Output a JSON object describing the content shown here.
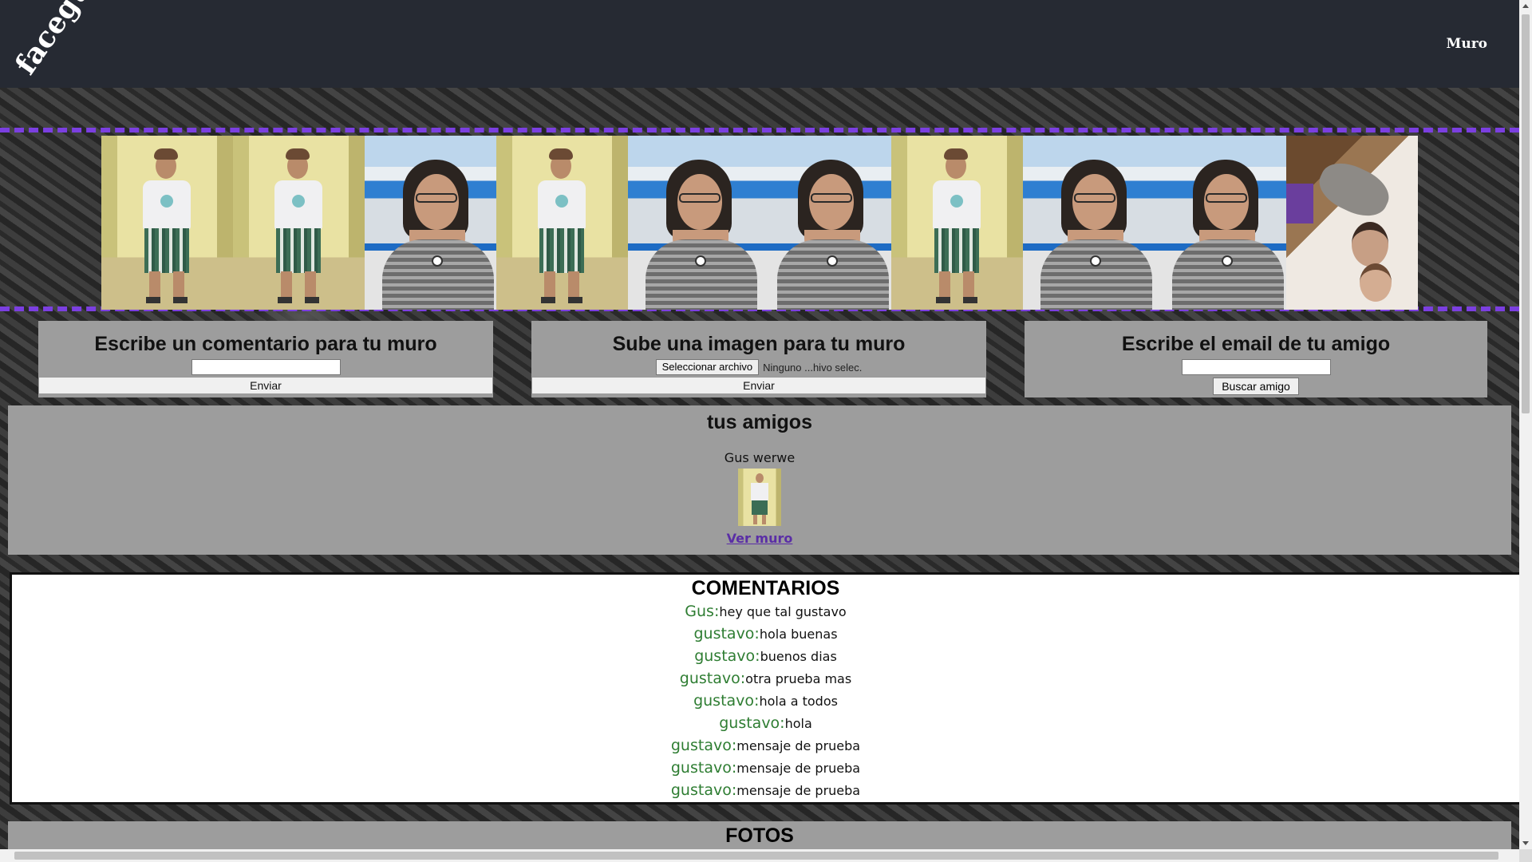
{
  "header": {
    "logo": "facegus",
    "nav_muro": "Muro"
  },
  "gallery": {
    "photos": [
      "man-photo",
      "man-photo",
      "woman-photo",
      "man-photo",
      "woman-photo",
      "woman-photo",
      "man-photo",
      "woman-photo",
      "woman-photo",
      "couple-cat-photo"
    ]
  },
  "comment_form": {
    "title": "Escribe un comentario para tu muro",
    "submit": "Enviar"
  },
  "image_form": {
    "title": "Sube una imagen para tu muro",
    "file_button": "Seleccionar archivo",
    "file_status": "Ninguno ...hivo selec.",
    "submit": "Enviar"
  },
  "friend_form": {
    "title": "Escribe el email de tu amigo",
    "submit": "Buscar amigo"
  },
  "friends": {
    "title": "tus amigos",
    "items": [
      {
        "name": "Gus werwe",
        "link": "Ver muro"
      }
    ]
  },
  "comments": {
    "title": "COMENTARIOS",
    "items": [
      {
        "author": "Gus:",
        "text": "hey que tal gustavo"
      },
      {
        "author": "gustavo:",
        "text": "hola buenas"
      },
      {
        "author": "gustavo:",
        "text": "buenos dias"
      },
      {
        "author": "gustavo:",
        "text": "otra prueba mas"
      },
      {
        "author": "gustavo:",
        "text": "hola a todos"
      },
      {
        "author": "gustavo:",
        "text": "hola"
      },
      {
        "author": "gustavo:",
        "text": "mensaje de prueba"
      },
      {
        "author": "gustavo:",
        "text": "mensaje de prueba"
      },
      {
        "author": "gustavo:",
        "text": "mensaje de prueba"
      }
    ]
  },
  "fotos": {
    "title": "FOTOS"
  },
  "colors": {
    "header_bg": "#262a33",
    "strip_border": "#7b3fe0",
    "card_bg": "#9d9d9d",
    "comment_author": "#2e7d32",
    "link": "#5a2ea6"
  }
}
